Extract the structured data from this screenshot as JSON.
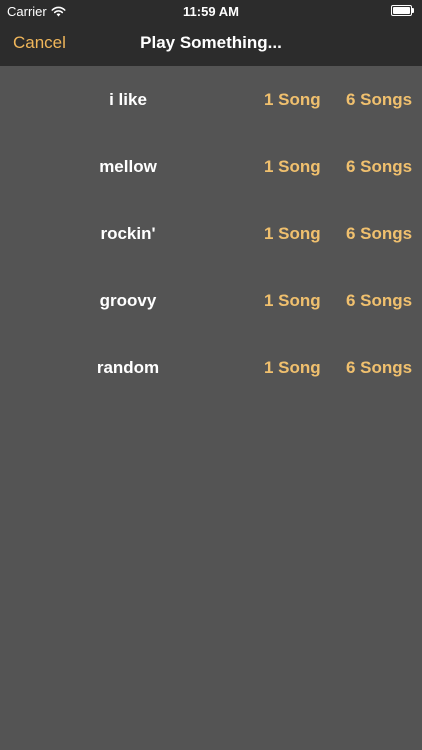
{
  "status_bar": {
    "carrier": "Carrier",
    "time": "11:59 AM",
    "wifi_icon": "wifi-icon",
    "battery_icon": "battery-icon",
    "battery_level": 1.0
  },
  "nav": {
    "cancel_label": "Cancel",
    "title": "Play Something..."
  },
  "rows": [
    {
      "label": "i like",
      "one_label": "1 Song",
      "six_label": "6 Songs"
    },
    {
      "label": "mellow",
      "one_label": "1 Song",
      "six_label": "6 Songs"
    },
    {
      "label": "rockin'",
      "one_label": "1 Song",
      "six_label": "6 Songs"
    },
    {
      "label": "groovy",
      "one_label": "1 Song",
      "six_label": "6 Songs"
    },
    {
      "label": "random",
      "one_label": "1 Song",
      "six_label": "6 Songs"
    }
  ],
  "colors": {
    "accent": "#f0b65a",
    "background": "#545454",
    "nav_background": "#2c2c2c"
  }
}
